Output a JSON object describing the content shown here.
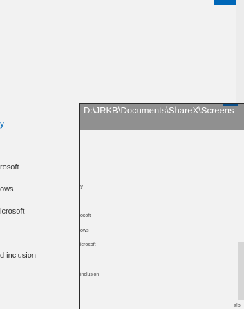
{
  "background_page": {
    "link": "y",
    "items": [
      "rosoft",
      "ows",
      "icrosoft",
      "d inclusion"
    ]
  },
  "viewer": {
    "title": "D:\\JRKB\\Documents\\ShareX\\Screens",
    "marker": "y",
    "items": [
      "osoft",
      "ows",
      "icrosoft",
      "inclusion"
    ],
    "corner_text": "a!b"
  },
  "colors": {
    "accent": "#0067b8",
    "titlebar": "#909090",
    "background": "#f2f2f2"
  }
}
